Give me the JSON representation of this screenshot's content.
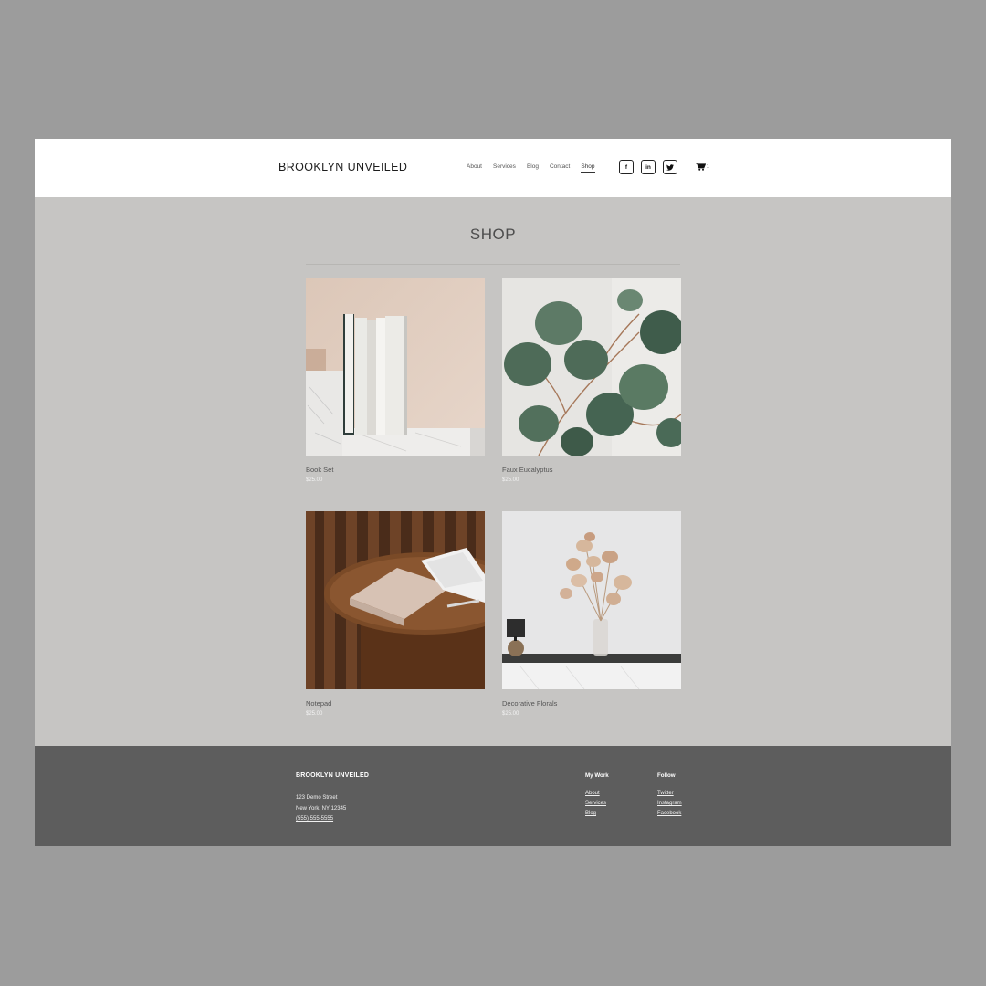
{
  "header": {
    "brand": "BROOKLYN UNVEILED",
    "nav": [
      "About",
      "Services",
      "Blog",
      "Contact",
      "Shop"
    ],
    "active_nav": "Shop",
    "socials": [
      {
        "icon": "facebook-icon",
        "glyph": "f"
      },
      {
        "icon": "linkedin-icon",
        "glyph": "in"
      },
      {
        "icon": "twitter-icon",
        "glyph": "t"
      }
    ],
    "cart_count": "1"
  },
  "shop": {
    "title": "SHOP",
    "products": [
      {
        "name": "Book Set",
        "price": "$25.00",
        "image": "books-on-marble"
      },
      {
        "name": "Faux Eucalyptus",
        "price": "$25.00",
        "image": "eucalyptus-leaves"
      },
      {
        "name": "Notepad",
        "price": "$25.00",
        "image": "notepad-on-wood-table"
      },
      {
        "name": "Decorative Florals",
        "price": "$25.00",
        "image": "dried-florals-vase"
      }
    ]
  },
  "footer": {
    "brand": "BROOKLYN UNVEILED",
    "address_line1": "123 Demo Street",
    "address_line2": "New York, NY 12345",
    "phone": "(555) 555-5555",
    "my_work": {
      "heading": "My Work",
      "links": [
        "About",
        "Services",
        "Blog"
      ]
    },
    "follow": {
      "heading": "Follow",
      "links": [
        "Twitter",
        "Instagram",
        "Facebook"
      ]
    }
  },
  "colors": {
    "background": "#9c9c9c",
    "header": "#ffffff",
    "main": "#c6c5c3",
    "footer": "#5d5d5d"
  }
}
